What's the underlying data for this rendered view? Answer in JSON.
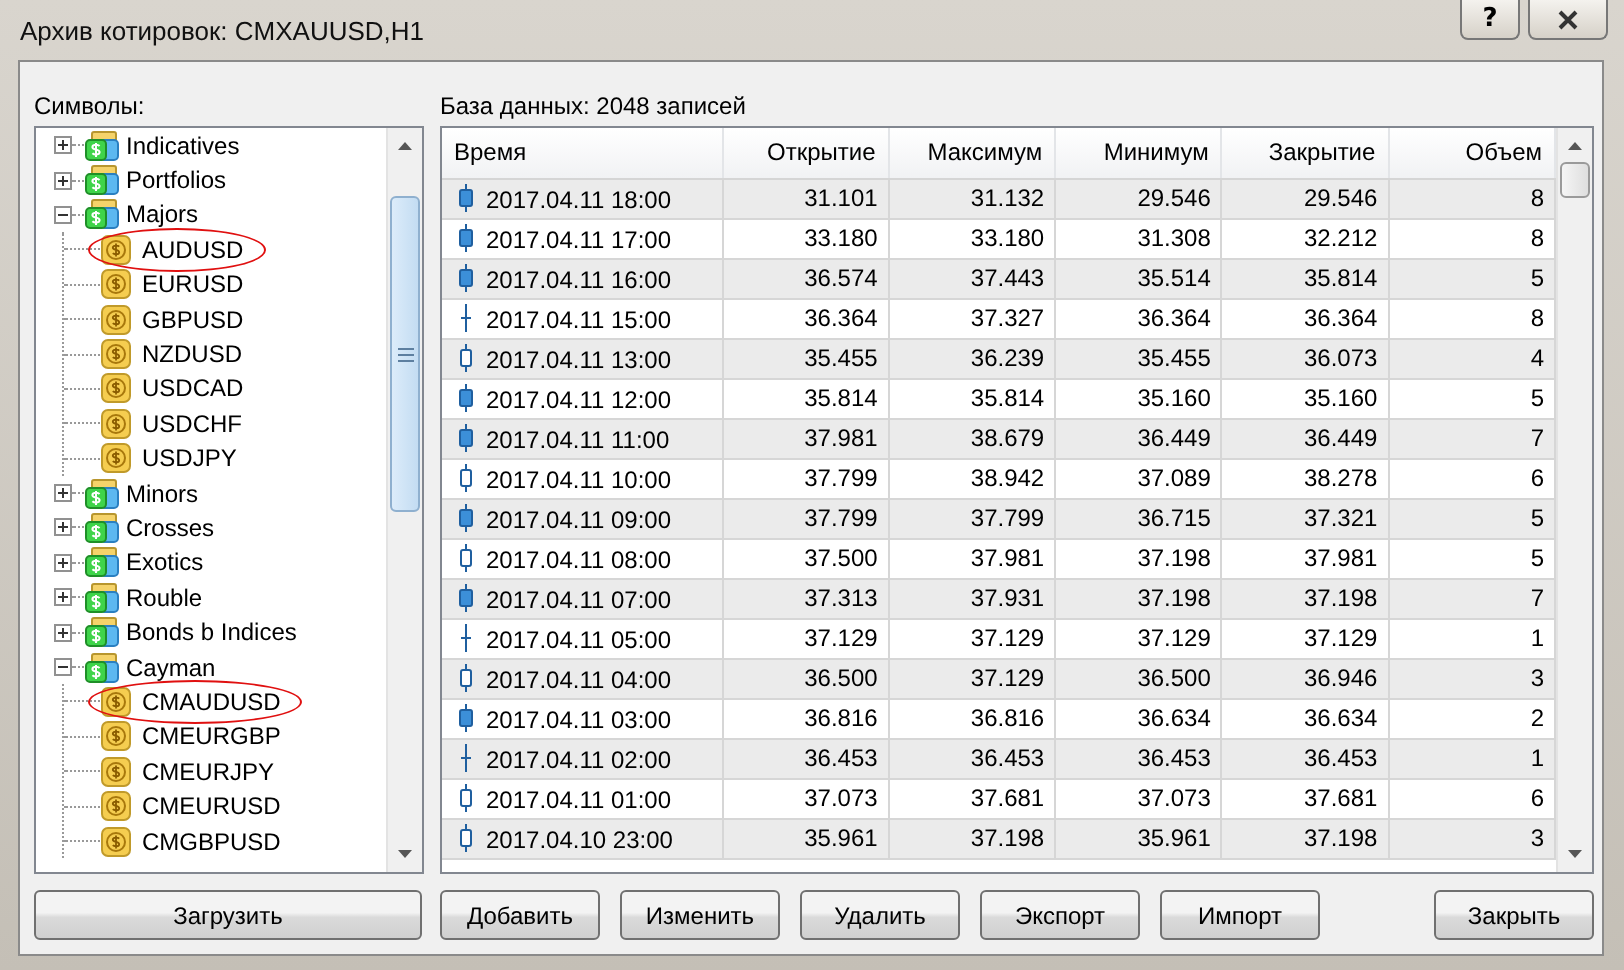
{
  "window": {
    "title": "Архив котировок: CMXAUUSD,H1",
    "help": "?"
  },
  "symbols": {
    "label": "Символы:",
    "tree": [
      {
        "label": "Indicatives",
        "expanded": false
      },
      {
        "label": "Portfolios",
        "expanded": false
      },
      {
        "label": "Majors",
        "expanded": true,
        "children": [
          {
            "label": "AUDUSD",
            "circled": true
          },
          {
            "label": "EURUSD",
            "circled": false
          },
          {
            "label": "GBPUSD",
            "circled": false
          },
          {
            "label": "NZDUSD",
            "circled": false
          },
          {
            "label": "USDCAD",
            "circled": false
          },
          {
            "label": "USDCHF",
            "circled": false
          },
          {
            "label": "USDJPY",
            "circled": false
          }
        ]
      },
      {
        "label": "Minors",
        "expanded": false
      },
      {
        "label": "Crosses",
        "expanded": false
      },
      {
        "label": "Exotics",
        "expanded": false
      },
      {
        "label": "Rouble",
        "expanded": false
      },
      {
        "label": "Bonds b Indices",
        "expanded": false
      },
      {
        "label": "Cayman",
        "expanded": true,
        "children": [
          {
            "label": "CMAUDUSD",
            "circled": true
          },
          {
            "label": "CMEURGBP",
            "circled": false
          },
          {
            "label": "CMEURJPY",
            "circled": false
          },
          {
            "label": "CMEURUSD",
            "circled": false
          },
          {
            "label": "CMGBPUSD",
            "circled": false
          }
        ]
      }
    ],
    "button": "Загрузить"
  },
  "database": {
    "caption": "База данных: 2048 записей",
    "columns": [
      "Время",
      "Открытие",
      "Максимум",
      "Минимум",
      "Закрытие",
      "Объем"
    ],
    "rows": [
      {
        "kind": "bear",
        "cells": [
          "2017.04.11 18:00",
          "31.101",
          "31.132",
          "29.546",
          "29.546",
          "8"
        ]
      },
      {
        "kind": "bear",
        "cells": [
          "2017.04.11 17:00",
          "33.180",
          "33.180",
          "31.308",
          "32.212",
          "8"
        ]
      },
      {
        "kind": "bear",
        "cells": [
          "2017.04.11 16:00",
          "36.574",
          "37.443",
          "35.514",
          "35.814",
          "5"
        ]
      },
      {
        "kind": "doji",
        "cells": [
          "2017.04.11 15:00",
          "36.364",
          "37.327",
          "36.364",
          "36.364",
          "8"
        ]
      },
      {
        "kind": "bull",
        "cells": [
          "2017.04.11 13:00",
          "35.455",
          "36.239",
          "35.455",
          "36.073",
          "4"
        ]
      },
      {
        "kind": "bear",
        "cells": [
          "2017.04.11 12:00",
          "35.814",
          "35.814",
          "35.160",
          "35.160",
          "5"
        ]
      },
      {
        "kind": "bear",
        "cells": [
          "2017.04.11 11:00",
          "37.981",
          "38.679",
          "36.449",
          "36.449",
          "7"
        ]
      },
      {
        "kind": "bull",
        "cells": [
          "2017.04.11 10:00",
          "37.799",
          "38.942",
          "37.089",
          "38.278",
          "6"
        ]
      },
      {
        "kind": "bear",
        "cells": [
          "2017.04.11 09:00",
          "37.799",
          "37.799",
          "36.715",
          "37.321",
          "5"
        ]
      },
      {
        "kind": "bull",
        "cells": [
          "2017.04.11 08:00",
          "37.500",
          "37.981",
          "37.198",
          "37.981",
          "5"
        ]
      },
      {
        "kind": "bear",
        "cells": [
          "2017.04.11 07:00",
          "37.313",
          "37.931",
          "37.198",
          "37.198",
          "7"
        ]
      },
      {
        "kind": "doji",
        "cells": [
          "2017.04.11 05:00",
          "37.129",
          "37.129",
          "37.129",
          "37.129",
          "1"
        ]
      },
      {
        "kind": "bull",
        "cells": [
          "2017.04.11 04:00",
          "36.500",
          "37.129",
          "36.500",
          "36.946",
          "3"
        ]
      },
      {
        "kind": "bear",
        "cells": [
          "2017.04.11 03:00",
          "36.816",
          "36.816",
          "36.634",
          "36.634",
          "2"
        ]
      },
      {
        "kind": "doji",
        "cells": [
          "2017.04.11 02:00",
          "36.453",
          "36.453",
          "36.453",
          "36.453",
          "1"
        ]
      },
      {
        "kind": "bull",
        "cells": [
          "2017.04.11 01:00",
          "37.073",
          "37.681",
          "37.073",
          "37.681",
          "6"
        ]
      },
      {
        "kind": "bull",
        "cells": [
          "2017.04.10 23:00",
          "35.961",
          "37.198",
          "35.961",
          "37.198",
          "3"
        ]
      }
    ],
    "buttons": [
      "Добавить",
      "Изменить",
      "Удалить",
      "Экспорт",
      "Импорт",
      "Закрыть"
    ]
  }
}
